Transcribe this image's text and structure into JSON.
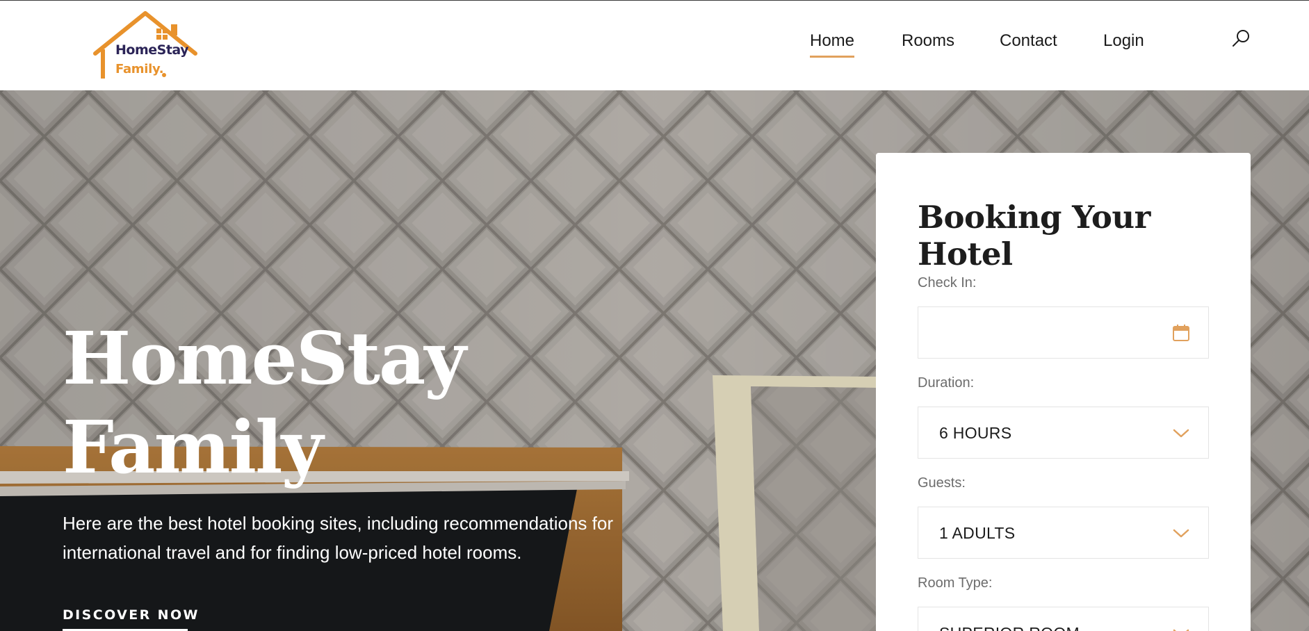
{
  "brand": {
    "logo_line1": "HomeStay",
    "logo_line2": "Family.",
    "accent_color": "#e1a15d",
    "logo_orange": "#e8922c",
    "logo_navy": "#2b2457"
  },
  "nav": {
    "items": [
      {
        "label": "Home",
        "active": true
      },
      {
        "label": "Rooms",
        "active": false
      },
      {
        "label": "Contact",
        "active": false
      },
      {
        "label": "Login",
        "active": false
      }
    ],
    "search_icon": "search-icon"
  },
  "hero": {
    "title_line1": "HomeStay",
    "title_line2": "Family",
    "description_line1": "Here are the best hotel booking sites, including recommendations for",
    "description_line2": "international travel and for finding low-priced hotel rooms.",
    "cta_label": "DISCOVER NOW"
  },
  "booking": {
    "title": "Booking Your Hotel",
    "check_in": {
      "label": "Check In:",
      "value": "",
      "icon": "calendar-icon"
    },
    "duration": {
      "label": "Duration:",
      "value": "6 HOURS",
      "icon": "chevron-down-icon"
    },
    "guests": {
      "label": "Guests:",
      "value": "1 ADULTS",
      "icon": "chevron-down-icon"
    },
    "room_type": {
      "label": "Room Type:",
      "value": "SUPERIOR ROOM",
      "icon": "chevron-down-icon"
    }
  }
}
